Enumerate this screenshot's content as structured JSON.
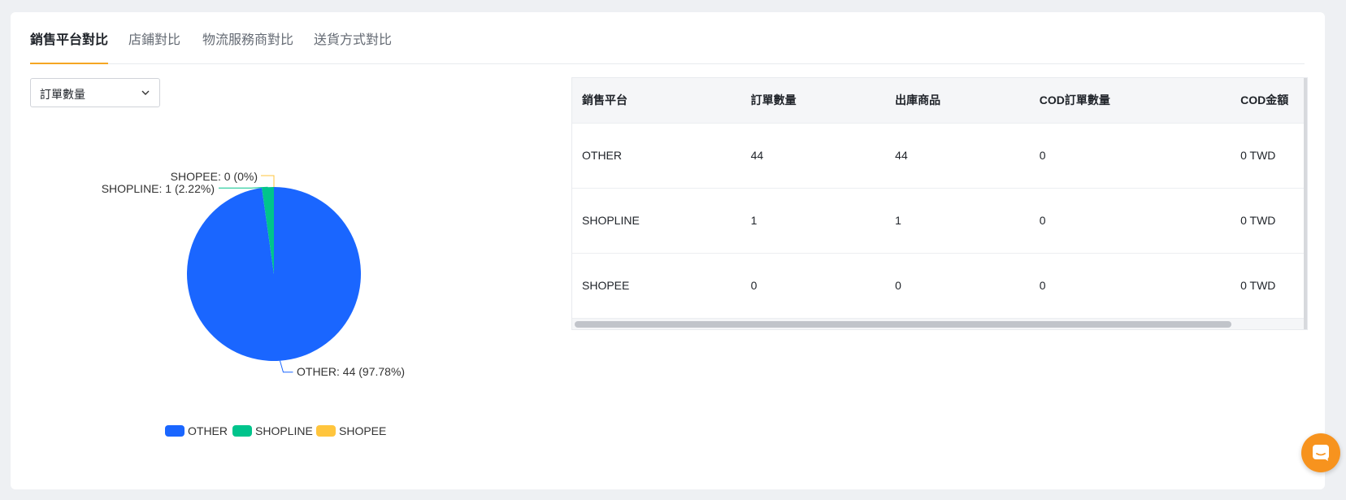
{
  "tabs": [
    {
      "label": "銷售平台對比",
      "active": true
    },
    {
      "label": "店鋪對比",
      "active": false
    },
    {
      "label": "物流服務商對比",
      "active": false
    },
    {
      "label": "送貨方式對比",
      "active": false
    }
  ],
  "metric_select": {
    "value": "訂單數量"
  },
  "chart_data": {
    "type": "pie",
    "categories": [
      "OTHER",
      "SHOPLINE",
      "SHOPEE"
    ],
    "values": [
      44,
      1,
      0
    ],
    "percents": [
      "97.78%",
      "2.22%",
      "0%"
    ],
    "labels": [
      "OTHER: 44 (97.78%)",
      "SHOPLINE: 1 (2.22%)",
      "SHOPEE: 0 (0%)"
    ],
    "colors": [
      "#1a66ff",
      "#00c48c",
      "#ffc53d"
    ],
    "legend_position": "bottom"
  },
  "table": {
    "columns": [
      "銷售平台",
      "訂單數量",
      "出庫商品",
      "COD訂單數量",
      "COD金額"
    ],
    "rows": [
      [
        "OTHER",
        "44",
        "44",
        "0",
        "0 TWD"
      ],
      [
        "SHOPLINE",
        "1",
        "1",
        "0",
        "0 TWD"
      ],
      [
        "SHOPEE",
        "0",
        "0",
        "0",
        "0 TWD"
      ]
    ]
  },
  "colors": {
    "accent": "#f5a623",
    "chat": "#f7931e"
  },
  "icons": {
    "select_caret": "chevron-down-icon",
    "chat": "chat-icon"
  }
}
